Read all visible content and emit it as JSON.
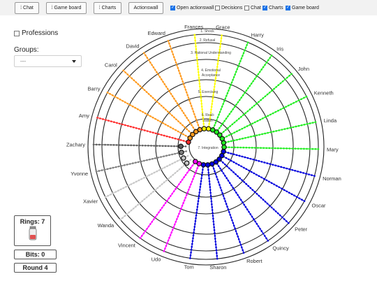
{
  "toolbar": {
    "buttons": [
      {
        "label": "Chat",
        "icon": "grip-icon"
      },
      {
        "label": "Game board",
        "icon": "grip-icon"
      },
      {
        "label": "Charts",
        "icon": "grip-icon"
      },
      {
        "label": "Actionswall"
      }
    ],
    "toggles": [
      {
        "label": "Open actionswall",
        "checked": true
      },
      {
        "label": "Decisions",
        "checked": false
      },
      {
        "label": "Chat",
        "checked": false
      },
      {
        "label": "Charts",
        "checked": true
      },
      {
        "label": "Game board",
        "checked": true
      }
    ]
  },
  "sidebar": {
    "professions_label": "Professions",
    "professions_checked": false,
    "groups_label": "Groups:",
    "groups_value": "---",
    "rings_label": "Rings: 7",
    "bits_label": "Bits: 0",
    "round_label": "Round 4"
  },
  "board": {
    "ring_labels": [
      "1. Shock",
      "2. Refusal",
      "3. Rational Understanding",
      "4. Emotional",
      "Acceptance",
      "5. Exercising",
      "6. Reali-",
      "zation",
      "7. Integration"
    ],
    "players": [
      {
        "name": "Amy",
        "color": "#ff2a2a",
        "progress": 7
      },
      {
        "name": "Barry",
        "color": "#ff9a1e",
        "progress": 7
      },
      {
        "name": "Carol",
        "color": "#ff9a1e",
        "progress": 7
      },
      {
        "name": "David",
        "color": "#ff9a1e",
        "progress": 7
      },
      {
        "name": "Edward",
        "color": "#ff9a1e",
        "progress": 7
      },
      {
        "name": "Frances",
        "color": "#ffff00",
        "progress": 7
      },
      {
        "name": "Grace",
        "color": "#ffff00",
        "progress": 7
      },
      {
        "name": "Harry",
        "color": "#22ee22",
        "progress": 7
      },
      {
        "name": "Iris",
        "color": "#22ee22",
        "progress": 7
      },
      {
        "name": "John",
        "color": "#22ee22",
        "progress": 7
      },
      {
        "name": "Kenneth",
        "color": "#22ee22",
        "progress": 7
      },
      {
        "name": "Linda",
        "color": "#22ee22",
        "progress": 7
      },
      {
        "name": "Mary",
        "color": "#22ee22",
        "progress": 7
      },
      {
        "name": "Norman",
        "color": "#0000dd",
        "progress": 7
      },
      {
        "name": "Oscar",
        "color": "#0000dd",
        "progress": 7
      },
      {
        "name": "Peter",
        "color": "#0000dd",
        "progress": 7
      },
      {
        "name": "Quincy",
        "color": "#0000dd",
        "progress": 7
      },
      {
        "name": "Robert",
        "color": "#0000dd",
        "progress": 7
      },
      {
        "name": "Sharon",
        "color": "#0000dd",
        "progress": 7
      },
      {
        "name": "Tom",
        "color": "#0000dd",
        "progress": 7
      },
      {
        "name": "Udo",
        "color": "#ff00ff",
        "progress": 7
      },
      {
        "name": "Vincent",
        "color": "#ff00ff",
        "progress": 7
      },
      {
        "name": "Wanda",
        "color": "#c8c8c8",
        "progress": 6
      },
      {
        "name": "Xavier",
        "color": "#c8c8c8",
        "progress": 6
      },
      {
        "name": "Yvonne",
        "color": "#808080",
        "progress": 6
      },
      {
        "name": "Zachary",
        "color": "#606060",
        "progress": 6
      }
    ]
  }
}
